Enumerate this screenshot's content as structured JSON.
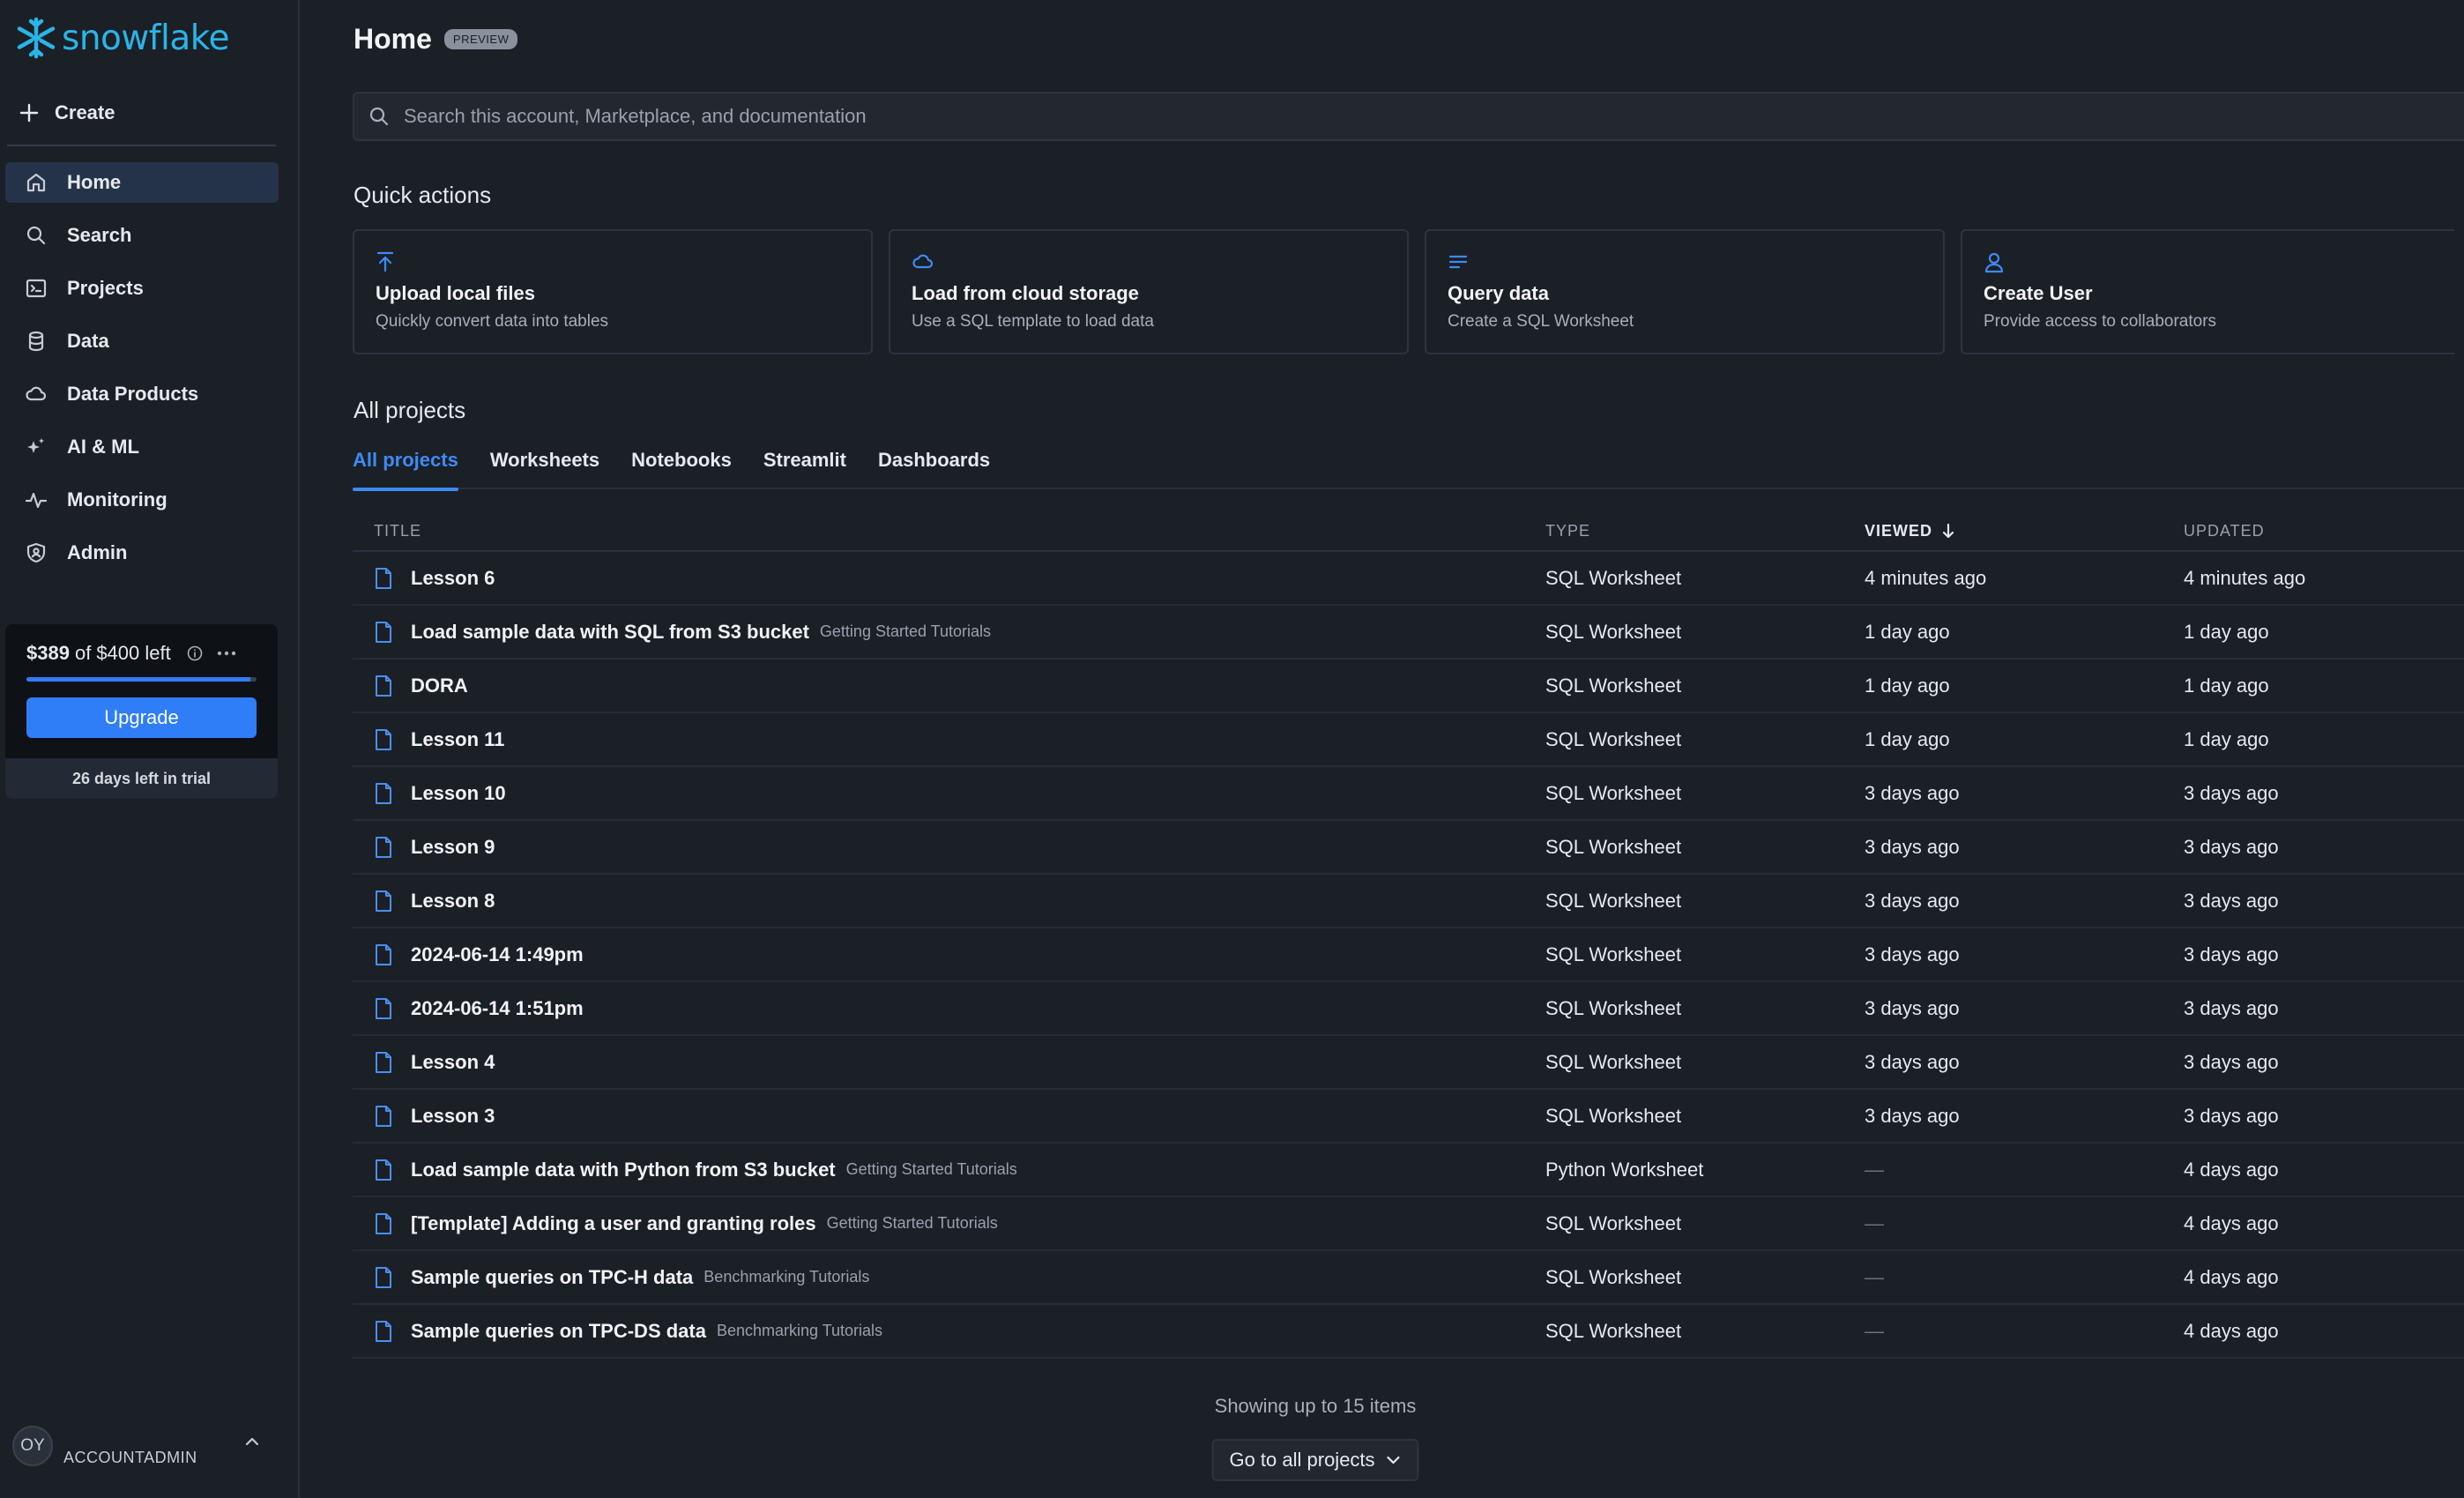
{
  "brand": {
    "name": "snowflake",
    "color": "#29b5e8"
  },
  "sidebar": {
    "create_label": "Create",
    "items": [
      {
        "label": "Home",
        "icon": "home-icon",
        "active": true
      },
      {
        "label": "Search",
        "icon": "search-icon"
      },
      {
        "label": "Projects",
        "icon": "projects-icon"
      },
      {
        "label": "Data",
        "icon": "database-icon"
      },
      {
        "label": "Data Products",
        "icon": "cloud-icon"
      },
      {
        "label": "AI & ML",
        "icon": "sparkle-icon"
      },
      {
        "label": "Monitoring",
        "icon": "activity-icon"
      },
      {
        "label": "Admin",
        "icon": "shield-user-icon"
      }
    ],
    "trial": {
      "amount": "$389",
      "of_text": "of",
      "total": "$400 left",
      "remaining_fraction": 0.9725,
      "upgrade_label": "Upgrade",
      "days_left": "26 days left in trial"
    },
    "user": {
      "initials": "OY",
      "role": "ACCOUNTADMIN"
    }
  },
  "header": {
    "title": "Home",
    "badge": "PREVIEW"
  },
  "search": {
    "placeholder": "Search this account, Marketplace, and documentation"
  },
  "quick_actions": {
    "title": "Quick actions",
    "cards": [
      {
        "title": "Upload local files",
        "subtitle": "Quickly convert data into tables",
        "icon": "upload-icon"
      },
      {
        "title": "Load from cloud storage",
        "subtitle": "Use a SQL template to load data",
        "icon": "cloud-icon"
      },
      {
        "title": "Query data",
        "subtitle": "Create a SQL Worksheet",
        "icon": "lines-icon"
      },
      {
        "title": "Create User",
        "subtitle": "Provide access to collaborators",
        "icon": "user-icon"
      }
    ]
  },
  "projects": {
    "title": "All projects",
    "tabs": [
      "All projects",
      "Worksheets",
      "Notebooks",
      "Streamlit",
      "Dashboards"
    ],
    "active_tab": "All projects",
    "columns": {
      "title": "TITLE",
      "type": "TYPE",
      "viewed": "VIEWED",
      "updated": "UPDATED"
    },
    "rows": [
      {
        "title": "Lesson 6",
        "tag": "",
        "type": "SQL Worksheet",
        "viewed": "4 minutes ago",
        "updated": "4 minutes ago"
      },
      {
        "title": "Load sample data with SQL from S3 bucket",
        "tag": "Getting Started Tutorials",
        "type": "SQL Worksheet",
        "viewed": "1 day ago",
        "updated": "1 day ago"
      },
      {
        "title": "DORA",
        "tag": "",
        "type": "SQL Worksheet",
        "viewed": "1 day ago",
        "updated": "1 day ago"
      },
      {
        "title": "Lesson 11",
        "tag": "",
        "type": "SQL Worksheet",
        "viewed": "1 day ago",
        "updated": "1 day ago"
      },
      {
        "title": "Lesson 10",
        "tag": "",
        "type": "SQL Worksheet",
        "viewed": "3 days ago",
        "updated": "3 days ago"
      },
      {
        "title": "Lesson 9",
        "tag": "",
        "type": "SQL Worksheet",
        "viewed": "3 days ago",
        "updated": "3 days ago"
      },
      {
        "title": "Lesson 8",
        "tag": "",
        "type": "SQL Worksheet",
        "viewed": "3 days ago",
        "updated": "3 days ago"
      },
      {
        "title": "2024-06-14 1:49pm",
        "tag": "",
        "type": "SQL Worksheet",
        "viewed": "3 days ago",
        "updated": "3 days ago"
      },
      {
        "title": "2024-06-14 1:51pm",
        "tag": "",
        "type": "SQL Worksheet",
        "viewed": "3 days ago",
        "updated": "3 days ago"
      },
      {
        "title": "Lesson 4",
        "tag": "",
        "type": "SQL Worksheet",
        "viewed": "3 days ago",
        "updated": "3 days ago"
      },
      {
        "title": "Lesson 3",
        "tag": "",
        "type": "SQL Worksheet",
        "viewed": "3 days ago",
        "updated": "3 days ago"
      },
      {
        "title": "Load sample data with Python from S3 bucket",
        "tag": "Getting Started Tutorials",
        "type": "Python Worksheet",
        "viewed": "—",
        "updated": "4 days ago"
      },
      {
        "title": "[Template] Adding a user and granting roles",
        "tag": "Getting Started Tutorials",
        "type": "SQL Worksheet",
        "viewed": "—",
        "updated": "4 days ago"
      },
      {
        "title": "Sample queries on TPC-H data",
        "tag": "Benchmarking Tutorials",
        "type": "SQL Worksheet",
        "viewed": "—",
        "updated": "4 days ago"
      },
      {
        "title": "Sample queries on TPC-DS data",
        "tag": "Benchmarking Tutorials",
        "type": "SQL Worksheet",
        "viewed": "—",
        "updated": "4 days ago"
      }
    ],
    "footer_text": "Showing up to 15 items",
    "all_button_label": "Go to all projects"
  },
  "colors": {
    "accent": "#3d8bf5",
    "background": "#1b1f26",
    "upgrade": "#2f7df7"
  }
}
